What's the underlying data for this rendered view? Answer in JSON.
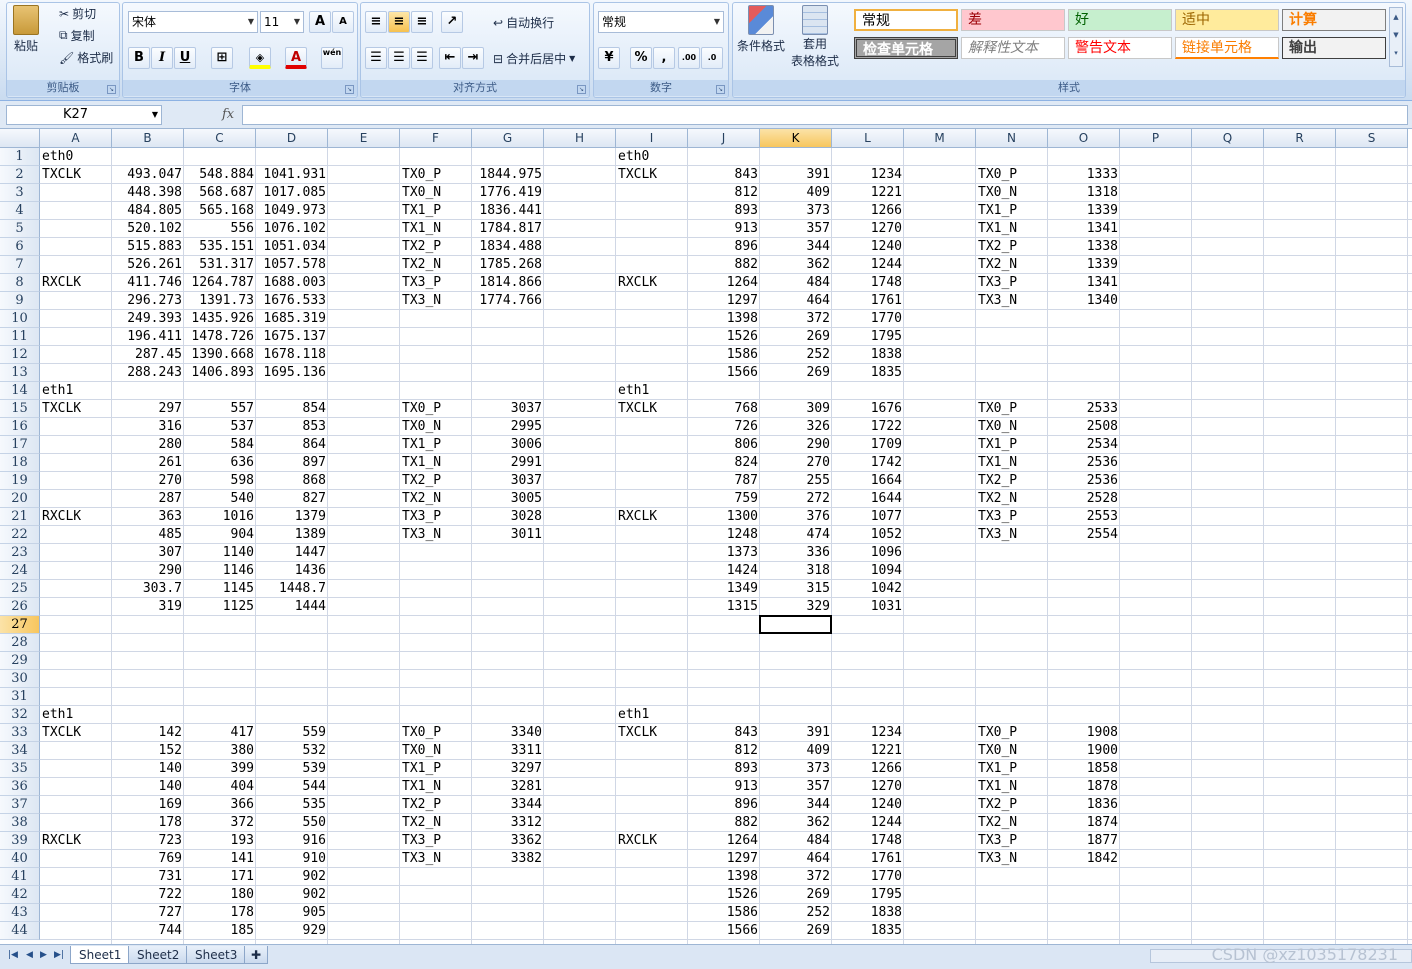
{
  "ribbon": {
    "clipboard": {
      "paste": "粘贴",
      "cut": "剪切",
      "copy": "复制",
      "format_painter": "格式刷",
      "label": "剪贴板"
    },
    "font": {
      "name": "宋体",
      "size": "11",
      "bold": "B",
      "italic": "I",
      "underline": "U",
      "grow": "A",
      "shrink": "A",
      "phonetic": "wén",
      "label": "字体"
    },
    "alignment": {
      "wrap": "自动换行",
      "merge": "合并后居中",
      "label": "对齐方式"
    },
    "number": {
      "format": "常规",
      "percent": "%",
      "comma": ",",
      "inc": ".00",
      "dec": ".0",
      "label": "数字"
    },
    "styles": {
      "conditional": "条件格式",
      "table_format_1": "套用",
      "table_format_2": "表格格式",
      "label": "样式",
      "boxes": [
        "常规",
        "差",
        "好",
        "适中",
        "计算",
        "检查单元格",
        "解释性文本",
        "警告文本",
        "链接单元格",
        "输出"
      ]
    }
  },
  "formula_bar": {
    "name_box": "K27",
    "fx": "fx",
    "content": ""
  },
  "columns": [
    "A",
    "B",
    "C",
    "D",
    "E",
    "F",
    "G",
    "H",
    "I",
    "J",
    "K",
    "L",
    "M",
    "N",
    "O",
    "P",
    "Q",
    "R",
    "S"
  ],
  "rows": [
    1,
    2,
    3,
    4,
    5,
    6,
    7,
    8,
    9,
    10,
    11,
    12,
    13,
    14,
    15,
    16,
    17,
    18,
    19,
    20,
    21,
    22,
    23,
    24,
    25,
    26,
    27,
    28,
    29,
    30,
    31,
    32,
    33,
    34,
    35,
    36,
    37,
    38,
    39,
    40,
    41,
    42,
    43,
    44
  ],
  "active_cell": {
    "col": "K",
    "row": 27
  },
  "cells": [
    [
      "A1",
      "eth0"
    ],
    [
      "I1",
      "eth0"
    ],
    [
      "A2",
      "TXCLK"
    ],
    [
      "B2",
      "493.047"
    ],
    [
      "C2",
      "548.884"
    ],
    [
      "D2",
      "1041.931"
    ],
    [
      "F2",
      "TX0_P"
    ],
    [
      "G2",
      "1844.975"
    ],
    [
      "I2",
      "TXCLK"
    ],
    [
      "J2",
      "843"
    ],
    [
      "K2",
      "391"
    ],
    [
      "L2",
      "1234"
    ],
    [
      "N2",
      "TX0_P"
    ],
    [
      "O2",
      "1333"
    ],
    [
      "B3",
      "448.398"
    ],
    [
      "C3",
      "568.687"
    ],
    [
      "D3",
      "1017.085"
    ],
    [
      "F3",
      "TX0_N"
    ],
    [
      "G3",
      "1776.419"
    ],
    [
      "J3",
      "812"
    ],
    [
      "K3",
      "409"
    ],
    [
      "L3",
      "1221"
    ],
    [
      "N3",
      "TX0_N"
    ],
    [
      "O3",
      "1318"
    ],
    [
      "B4",
      "484.805"
    ],
    [
      "C4",
      "565.168"
    ],
    [
      "D4",
      "1049.973"
    ],
    [
      "F4",
      "TX1_P"
    ],
    [
      "G4",
      "1836.441"
    ],
    [
      "J4",
      "893"
    ],
    [
      "K4",
      "373"
    ],
    [
      "L4",
      "1266"
    ],
    [
      "N4",
      "TX1_P"
    ],
    [
      "O4",
      "1339"
    ],
    [
      "B5",
      "520.102"
    ],
    [
      "C5",
      "556"
    ],
    [
      "D5",
      "1076.102"
    ],
    [
      "F5",
      "TX1_N"
    ],
    [
      "G5",
      "1784.817"
    ],
    [
      "J5",
      "913"
    ],
    [
      "K5",
      "357"
    ],
    [
      "L5",
      "1270"
    ],
    [
      "N5",
      "TX1_N"
    ],
    [
      "O5",
      "1341"
    ],
    [
      "B6",
      "515.883"
    ],
    [
      "C6",
      "535.151"
    ],
    [
      "D6",
      "1051.034"
    ],
    [
      "F6",
      "TX2_P"
    ],
    [
      "G6",
      "1834.488"
    ],
    [
      "J6",
      "896"
    ],
    [
      "K6",
      "344"
    ],
    [
      "L6",
      "1240"
    ],
    [
      "N6",
      "TX2_P"
    ],
    [
      "O6",
      "1338"
    ],
    [
      "B7",
      "526.261"
    ],
    [
      "C7",
      "531.317"
    ],
    [
      "D7",
      "1057.578"
    ],
    [
      "F7",
      "TX2_N"
    ],
    [
      "G7",
      "1785.268"
    ],
    [
      "J7",
      "882"
    ],
    [
      "K7",
      "362"
    ],
    [
      "L7",
      "1244"
    ],
    [
      "N7",
      "TX2_N"
    ],
    [
      "O7",
      "1339"
    ],
    [
      "A8",
      "RXCLK"
    ],
    [
      "B8",
      "411.746"
    ],
    [
      "C8",
      "1264.787"
    ],
    [
      "D8",
      "1688.003"
    ],
    [
      "F8",
      "TX3_P"
    ],
    [
      "G8",
      "1814.866"
    ],
    [
      "I8",
      "RXCLK"
    ],
    [
      "J8",
      "1264"
    ],
    [
      "K8",
      "484"
    ],
    [
      "L8",
      "1748"
    ],
    [
      "N8",
      "TX3_P"
    ],
    [
      "O8",
      "1341"
    ],
    [
      "B9",
      "296.273"
    ],
    [
      "C9",
      "1391.73"
    ],
    [
      "D9",
      "1676.533"
    ],
    [
      "F9",
      "TX3_N"
    ],
    [
      "G9",
      "1774.766"
    ],
    [
      "J9",
      "1297"
    ],
    [
      "K9",
      "464"
    ],
    [
      "L9",
      "1761"
    ],
    [
      "N9",
      "TX3_N"
    ],
    [
      "O9",
      "1340"
    ],
    [
      "B10",
      "249.393"
    ],
    [
      "C10",
      "1435.926"
    ],
    [
      "D10",
      "1685.319"
    ],
    [
      "J10",
      "1398"
    ],
    [
      "K10",
      "372"
    ],
    [
      "L10",
      "1770"
    ],
    [
      "B11",
      "196.411"
    ],
    [
      "C11",
      "1478.726"
    ],
    [
      "D11",
      "1675.137"
    ],
    [
      "J11",
      "1526"
    ],
    [
      "K11",
      "269"
    ],
    [
      "L11",
      "1795"
    ],
    [
      "B12",
      "287.45"
    ],
    [
      "C12",
      "1390.668"
    ],
    [
      "D12",
      "1678.118"
    ],
    [
      "J12",
      "1586"
    ],
    [
      "K12",
      "252"
    ],
    [
      "L12",
      "1838"
    ],
    [
      "B13",
      "288.243"
    ],
    [
      "C13",
      "1406.893"
    ],
    [
      "D13",
      "1695.136"
    ],
    [
      "J13",
      "1566"
    ],
    [
      "K13",
      "269"
    ],
    [
      "L13",
      "1835"
    ],
    [
      "A14",
      "eth1"
    ],
    [
      "I14",
      "eth1"
    ],
    [
      "A15",
      "TXCLK"
    ],
    [
      "B15",
      "297"
    ],
    [
      "C15",
      "557"
    ],
    [
      "D15",
      "854"
    ],
    [
      "F15",
      "TX0_P"
    ],
    [
      "G15",
      "3037"
    ],
    [
      "I15",
      "TXCLK"
    ],
    [
      "J15",
      "768"
    ],
    [
      "K15",
      "309"
    ],
    [
      "L15",
      "1676"
    ],
    [
      "N15",
      "TX0_P"
    ],
    [
      "O15",
      "2533"
    ],
    [
      "B16",
      "316"
    ],
    [
      "C16",
      "537"
    ],
    [
      "D16",
      "853"
    ],
    [
      "F16",
      "TX0_N"
    ],
    [
      "G16",
      "2995"
    ],
    [
      "J16",
      "726"
    ],
    [
      "K16",
      "326"
    ],
    [
      "L16",
      "1722"
    ],
    [
      "N16",
      "TX0_N"
    ],
    [
      "O16",
      "2508"
    ],
    [
      "B17",
      "280"
    ],
    [
      "C17",
      "584"
    ],
    [
      "D17",
      "864"
    ],
    [
      "F17",
      "TX1_P"
    ],
    [
      "G17",
      "3006"
    ],
    [
      "J17",
      "806"
    ],
    [
      "K17",
      "290"
    ],
    [
      "L17",
      "1709"
    ],
    [
      "N17",
      "TX1_P"
    ],
    [
      "O17",
      "2534"
    ],
    [
      "B18",
      "261"
    ],
    [
      "C18",
      "636"
    ],
    [
      "D18",
      "897"
    ],
    [
      "F18",
      "TX1_N"
    ],
    [
      "G18",
      "2991"
    ],
    [
      "J18",
      "824"
    ],
    [
      "K18",
      "270"
    ],
    [
      "L18",
      "1742"
    ],
    [
      "N18",
      "TX1_N"
    ],
    [
      "O18",
      "2536"
    ],
    [
      "B19",
      "270"
    ],
    [
      "C19",
      "598"
    ],
    [
      "D19",
      "868"
    ],
    [
      "F19",
      "TX2_P"
    ],
    [
      "G19",
      "3037"
    ],
    [
      "J19",
      "787"
    ],
    [
      "K19",
      "255"
    ],
    [
      "L19",
      "1664"
    ],
    [
      "N19",
      "TX2_P"
    ],
    [
      "O19",
      "2536"
    ],
    [
      "B20",
      "287"
    ],
    [
      "C20",
      "540"
    ],
    [
      "D20",
      "827"
    ],
    [
      "F20",
      "TX2_N"
    ],
    [
      "G20",
      "3005"
    ],
    [
      "J20",
      "759"
    ],
    [
      "K20",
      "272"
    ],
    [
      "L20",
      "1644"
    ],
    [
      "N20",
      "TX2_N"
    ],
    [
      "O20",
      "2528"
    ],
    [
      "A21",
      "RXCLK"
    ],
    [
      "B21",
      "363"
    ],
    [
      "C21",
      "1016"
    ],
    [
      "D21",
      "1379"
    ],
    [
      "F21",
      "TX3_P"
    ],
    [
      "G21",
      "3028"
    ],
    [
      "I21",
      "RXCLK"
    ],
    [
      "J21",
      "1300"
    ],
    [
      "K21",
      "376"
    ],
    [
      "L21",
      "1077"
    ],
    [
      "N21",
      "TX3_P"
    ],
    [
      "O21",
      "2553"
    ],
    [
      "B22",
      "485"
    ],
    [
      "C22",
      "904"
    ],
    [
      "D22",
      "1389"
    ],
    [
      "F22",
      "TX3_N"
    ],
    [
      "G22",
      "3011"
    ],
    [
      "J22",
      "1248"
    ],
    [
      "K22",
      "474"
    ],
    [
      "L22",
      "1052"
    ],
    [
      "N22",
      "TX3_N"
    ],
    [
      "O22",
      "2554"
    ],
    [
      "B23",
      "307"
    ],
    [
      "C23",
      "1140"
    ],
    [
      "D23",
      "1447"
    ],
    [
      "J23",
      "1373"
    ],
    [
      "K23",
      "336"
    ],
    [
      "L23",
      "1096"
    ],
    [
      "B24",
      "290"
    ],
    [
      "C24",
      "1146"
    ],
    [
      "D24",
      "1436"
    ],
    [
      "J24",
      "1424"
    ],
    [
      "K24",
      "318"
    ],
    [
      "L24",
      "1094"
    ],
    [
      "B25",
      "303.7"
    ],
    [
      "C25",
      "1145"
    ],
    [
      "D25",
      "1448.7"
    ],
    [
      "J25",
      "1349"
    ],
    [
      "K25",
      "315"
    ],
    [
      "L25",
      "1042"
    ],
    [
      "B26",
      "319"
    ],
    [
      "C26",
      "1125"
    ],
    [
      "D26",
      "1444"
    ],
    [
      "J26",
      "1315"
    ],
    [
      "K26",
      "329"
    ],
    [
      "L26",
      "1031"
    ],
    [
      "A32",
      "eth1"
    ],
    [
      "I32",
      "eth1"
    ],
    [
      "A33",
      "TXCLK"
    ],
    [
      "B33",
      "142"
    ],
    [
      "C33",
      "417"
    ],
    [
      "D33",
      "559"
    ],
    [
      "F33",
      "TX0_P"
    ],
    [
      "G33",
      "3340"
    ],
    [
      "I33",
      "TXCLK"
    ],
    [
      "J33",
      "843"
    ],
    [
      "K33",
      "391"
    ],
    [
      "L33",
      "1234"
    ],
    [
      "N33",
      "TX0_P"
    ],
    [
      "O33",
      "1908"
    ],
    [
      "B34",
      "152"
    ],
    [
      "C34",
      "380"
    ],
    [
      "D34",
      "532"
    ],
    [
      "F34",
      "TX0_N"
    ],
    [
      "G34",
      "3311"
    ],
    [
      "J34",
      "812"
    ],
    [
      "K34",
      "409"
    ],
    [
      "L34",
      "1221"
    ],
    [
      "N34",
      "TX0_N"
    ],
    [
      "O34",
      "1900"
    ],
    [
      "B35",
      "140"
    ],
    [
      "C35",
      "399"
    ],
    [
      "D35",
      "539"
    ],
    [
      "F35",
      "TX1_P"
    ],
    [
      "G35",
      "3297"
    ],
    [
      "J35",
      "893"
    ],
    [
      "K35",
      "373"
    ],
    [
      "L35",
      "1266"
    ],
    [
      "N35",
      "TX1_P"
    ],
    [
      "O35",
      "1858"
    ],
    [
      "B36",
      "140"
    ],
    [
      "C36",
      "404"
    ],
    [
      "D36",
      "544"
    ],
    [
      "F36",
      "TX1_N"
    ],
    [
      "G36",
      "3281"
    ],
    [
      "J36",
      "913"
    ],
    [
      "K36",
      "357"
    ],
    [
      "L36",
      "1270"
    ],
    [
      "N36",
      "TX1_N"
    ],
    [
      "O36",
      "1878"
    ],
    [
      "B37",
      "169"
    ],
    [
      "C37",
      "366"
    ],
    [
      "D37",
      "535"
    ],
    [
      "F37",
      "TX2_P"
    ],
    [
      "G37",
      "3344"
    ],
    [
      "J37",
      "896"
    ],
    [
      "K37",
      "344"
    ],
    [
      "L37",
      "1240"
    ],
    [
      "N37",
      "TX2_P"
    ],
    [
      "O37",
      "1836"
    ],
    [
      "B38",
      "178"
    ],
    [
      "C38",
      "372"
    ],
    [
      "D38",
      "550"
    ],
    [
      "F38",
      "TX2_N"
    ],
    [
      "G38",
      "3312"
    ],
    [
      "J38",
      "882"
    ],
    [
      "K38",
      "362"
    ],
    [
      "L38",
      "1244"
    ],
    [
      "N38",
      "TX2_N"
    ],
    [
      "O38",
      "1874"
    ],
    [
      "A39",
      "RXCLK"
    ],
    [
      "B39",
      "723"
    ],
    [
      "C39",
      "193"
    ],
    [
      "D39",
      "916"
    ],
    [
      "F39",
      "TX3_P"
    ],
    [
      "G39",
      "3362"
    ],
    [
      "I39",
      "RXCLK"
    ],
    [
      "J39",
      "1264"
    ],
    [
      "K39",
      "484"
    ],
    [
      "L39",
      "1748"
    ],
    [
      "N39",
      "TX3_P"
    ],
    [
      "O39",
      "1877"
    ],
    [
      "B40",
      "769"
    ],
    [
      "C40",
      "141"
    ],
    [
      "D40",
      "910"
    ],
    [
      "F40",
      "TX3_N"
    ],
    [
      "G40",
      "3382"
    ],
    [
      "J40",
      "1297"
    ],
    [
      "K40",
      "464"
    ],
    [
      "L40",
      "1761"
    ],
    [
      "N40",
      "TX3_N"
    ],
    [
      "O40",
      "1842"
    ],
    [
      "B41",
      "731"
    ],
    [
      "C41",
      "171"
    ],
    [
      "D41",
      "902"
    ],
    [
      "J41",
      "1398"
    ],
    [
      "K41",
      "372"
    ],
    [
      "L41",
      "1770"
    ],
    [
      "B42",
      "722"
    ],
    [
      "C42",
      "180"
    ],
    [
      "D42",
      "902"
    ],
    [
      "J42",
      "1526"
    ],
    [
      "K42",
      "269"
    ],
    [
      "L42",
      "1795"
    ],
    [
      "B43",
      "727"
    ],
    [
      "C43",
      "178"
    ],
    [
      "D43",
      "905"
    ],
    [
      "J43",
      "1586"
    ],
    [
      "K43",
      "252"
    ],
    [
      "L43",
      "1838"
    ],
    [
      "B44",
      "744"
    ],
    [
      "C44",
      "185"
    ],
    [
      "D44",
      "929"
    ],
    [
      "J44",
      "1566"
    ],
    [
      "K44",
      "269"
    ],
    [
      "L44",
      "1835"
    ]
  ],
  "sheets": [
    "Sheet1",
    "Sheet2",
    "Sheet3"
  ],
  "active_sheet": "Sheet1",
  "watermark": "CSDN @xz1035178231"
}
